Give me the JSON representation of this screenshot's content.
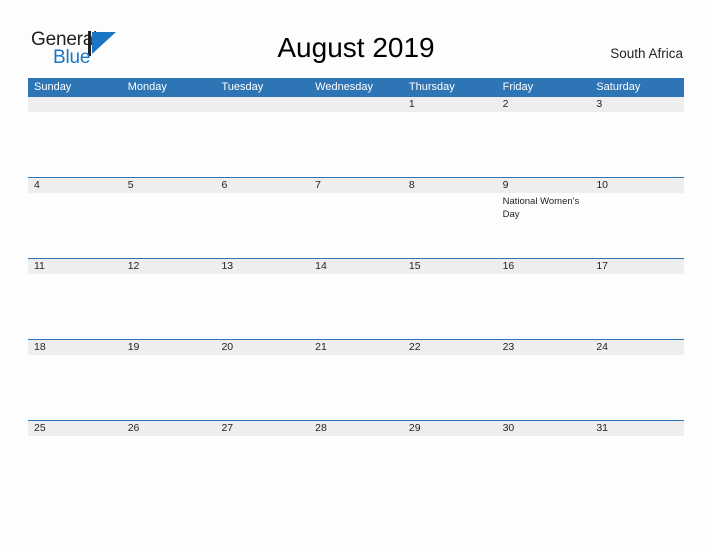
{
  "branding": {
    "logo_primary": "General",
    "logo_secondary": "Blue",
    "logo_mark_icon": "blue-flag-triangle-icon"
  },
  "header": {
    "title": "August 2019",
    "region": "South Africa"
  },
  "calendar": {
    "month": "August",
    "year": "2019",
    "day_headers": [
      "Sunday",
      "Monday",
      "Tuesday",
      "Wednesday",
      "Thursday",
      "Friday",
      "Saturday"
    ],
    "accent_color": "#2e75b6",
    "band_color": "#eeeeee",
    "weeks": [
      {
        "dates": [
          "",
          "",
          "",
          "",
          "1",
          "2",
          "3"
        ],
        "events": [
          "",
          "",
          "",
          "",
          "",
          "",
          ""
        ]
      },
      {
        "dates": [
          "4",
          "5",
          "6",
          "7",
          "8",
          "9",
          "10"
        ],
        "events": [
          "",
          "",
          "",
          "",
          "",
          "National Women's Day",
          ""
        ]
      },
      {
        "dates": [
          "11",
          "12",
          "13",
          "14",
          "15",
          "16",
          "17"
        ],
        "events": [
          "",
          "",
          "",
          "",
          "",
          "",
          ""
        ]
      },
      {
        "dates": [
          "18",
          "19",
          "20",
          "21",
          "22",
          "23",
          "24"
        ],
        "events": [
          "",
          "",
          "",
          "",
          "",
          "",
          ""
        ]
      },
      {
        "dates": [
          "25",
          "26",
          "27",
          "28",
          "29",
          "30",
          "31"
        ],
        "events": [
          "",
          "",
          "",
          "",
          "",
          "",
          ""
        ]
      }
    ]
  }
}
